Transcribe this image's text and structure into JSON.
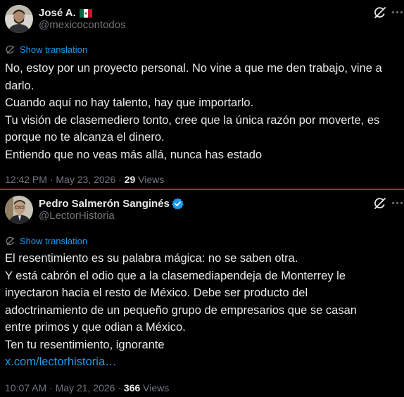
{
  "colors": {
    "background": "#000000",
    "text": "#e7e9ea",
    "muted": "#71767b",
    "accent": "#1d9bf0",
    "divider": "#c4202c"
  },
  "tweets": [
    {
      "author": {
        "name": "José A.",
        "handle": "@mexicocontodos",
        "badge": "mexico-flag-icon",
        "verified": false
      },
      "show_translation": "Show translation",
      "lines": [
        "No, estoy por un proyecto personal. No vine a que me den trabajo, vine a",
        "darlo.",
        "Cuando aquí no hay talento, hay que importarlo.",
        "Tu visión de clasemediero tonto, cree que la única razón por moverte, es",
        "porque no te alcanza el dinero.",
        "Entiendo que no veas más allá, nunca has estado"
      ],
      "time": "12:42 PM",
      "separator": "·",
      "date": "May 23, 2026",
      "views_count": "29",
      "views_label": "Views"
    },
    {
      "author": {
        "name": "Pedro Salmerón Sanginés",
        "handle": "@LectorHistoria",
        "badge": "verified-badge-icon",
        "verified": true
      },
      "show_translation": "Show translation",
      "lines": [
        "El resentimiento es su palabra mágica: no se saben otra.",
        "Y está cabrón el odio que a la clasemediapendeja de Monterrey le",
        "inyectaron hacia el resto de México. Debe ser producto del",
        "adoctrinamiento de un pequeño grupo de empresarios que se casan",
        "entre primos y que odian a México.",
        "Ten tu resentimiento, ignorante"
      ],
      "link": "x.com/lectorhistoria…",
      "time": "10:07 AM",
      "separator": "·",
      "date": "May 21, 2026",
      "views_count": "366",
      "views_label": "Views"
    }
  ]
}
